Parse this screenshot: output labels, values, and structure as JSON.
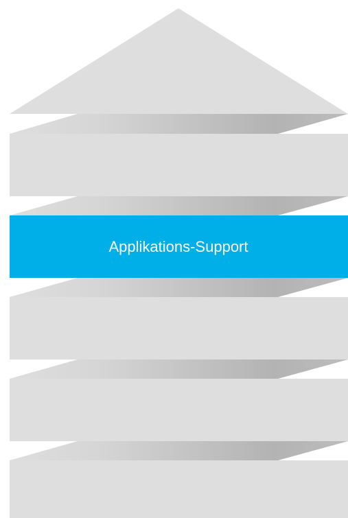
{
  "diagram": {
    "layers": [
      {
        "label": "",
        "highlighted": false
      },
      {
        "label": "Applikations-Support",
        "highlighted": true
      },
      {
        "label": "",
        "highlighted": false
      },
      {
        "label": "",
        "highlighted": false
      },
      {
        "label": "",
        "highlighted": false
      }
    ],
    "colors": {
      "layer": "#dedede",
      "roof": "#dedede",
      "highlight": "#00aee8",
      "connector_dark": "#b3b3b3",
      "connector_light": "#dedede",
      "label_text": "#ffffff"
    }
  }
}
